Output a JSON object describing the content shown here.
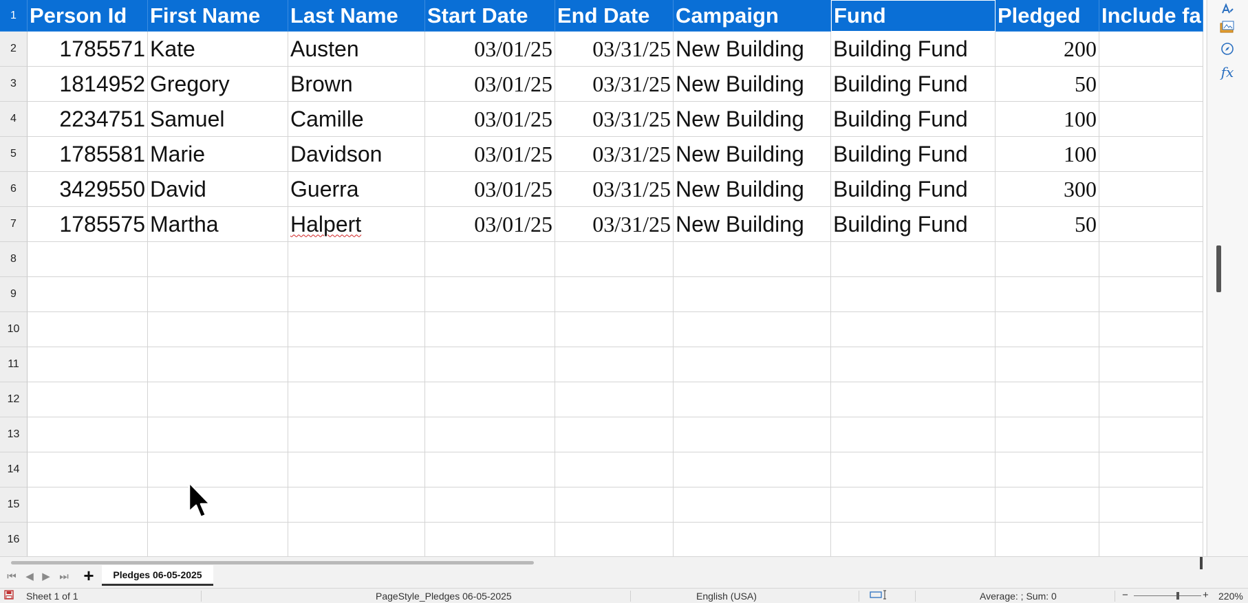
{
  "columns": [
    "Person Id",
    "First Name",
    "Last Name",
    "Start Date",
    "End Date",
    "Campaign",
    "Fund",
    "Pledged",
    "Include fa"
  ],
  "rows": [
    {
      "num": "2",
      "cells": [
        "1785571",
        "Kate",
        "Austen",
        "03/01/25",
        "03/31/25",
        "New Building",
        "Building Fund",
        "200",
        ""
      ]
    },
    {
      "num": "3",
      "cells": [
        "1814952",
        "Gregory",
        "Brown",
        "03/01/25",
        "03/31/25",
        "New Building",
        "Building Fund",
        "50",
        ""
      ]
    },
    {
      "num": "4",
      "cells": [
        "2234751",
        "Samuel",
        "Camille",
        "03/01/25",
        "03/31/25",
        "New Building",
        "Building Fund",
        "100",
        ""
      ]
    },
    {
      "num": "5",
      "cells": [
        "1785581",
        "Marie",
        "Davidson",
        "03/01/25",
        "03/31/25",
        "New Building",
        "Building Fund",
        "100",
        ""
      ]
    },
    {
      "num": "6",
      "cells": [
        "3429550",
        "David",
        "Guerra",
        "03/01/25",
        "03/31/25",
        "New Building",
        "Building Fund",
        "300",
        ""
      ]
    },
    {
      "num": "7",
      "cells": [
        "1785575",
        "Martha",
        "Halpert",
        "03/01/25",
        "03/31/25",
        "New Building",
        "Building Fund",
        "50",
        ""
      ]
    }
  ],
  "header_row_num": "1",
  "empty_row_nums": [
    "8",
    "9",
    "10",
    "11",
    "12",
    "13",
    "14",
    "15",
    "16"
  ],
  "selected_column": "Fund",
  "spellcheck_value": "Halpert",
  "sheet_tab": {
    "label": "Pledges 06-05-2025",
    "add_icon": "plus-icon"
  },
  "status": {
    "sheet": "Sheet 1 of 1",
    "page_style": "PageStyle_Pledges 06-05-2025",
    "language": "English (USA)",
    "selection": "Average: ; Sum: 0",
    "zoom_minus": "−",
    "zoom_plus": "+",
    "zoom": "220%"
  },
  "side_icons": [
    "styles-icon",
    "gallery-icon",
    "navigator-icon",
    "functions-icon"
  ],
  "colors": {
    "header_bg": "#0a6fd6",
    "header_text": "#ffffff",
    "accent": "#2a6fc0"
  }
}
